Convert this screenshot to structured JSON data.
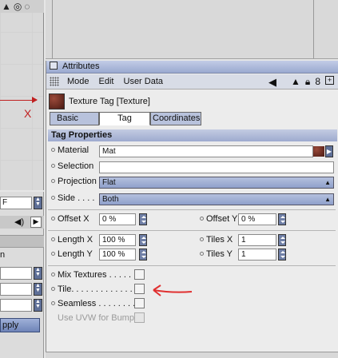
{
  "left_panel": {
    "top_icons": [
      "▲",
      "◎",
      "◌"
    ],
    "axis_label": "X",
    "field1_value": "F",
    "field3_value": "n",
    "apply_label": "pply"
  },
  "attributes": {
    "title": "Attributes",
    "menu": [
      "Mode",
      "Edit",
      "User Data"
    ],
    "menu_icons": [
      "back-arrow-icon",
      "up-arrow-icon",
      "lock-icon",
      "hierarchy-icon",
      "new-window-icon"
    ],
    "tag_title": "Texture Tag [Texture]",
    "tabs": [
      "Basic",
      "Tag",
      "Coordinates"
    ],
    "active_tab": "Tag",
    "section_title": "Tag Properties",
    "material_label": "Material",
    "material_value": "Mat",
    "selection_label": "Selection",
    "selection_value": "",
    "projection_label": "Projection",
    "projection_value": "Flat",
    "side_label": "Side . . . .",
    "side_value": "Both",
    "offset_x_label": "Offset X",
    "offset_x_value": "0 %",
    "offset_y_label": "Offset Y",
    "offset_y_value": "0 %",
    "length_x_label": "Length X",
    "length_x_value": "100 %",
    "tiles_x_label": "Tiles X",
    "tiles_x_value": "1",
    "length_y_label": "Length Y",
    "length_y_value": "100 %",
    "tiles_y_label": "Tiles Y",
    "tiles_y_value": "1",
    "mix_textures_label": "Mix Textures . . . . . .",
    "tile_label": "Tile. . . . . . . . . . . . .",
    "seamless_label": "Seamless . . . . . . . .",
    "use_uvw_label": "Use UVW for Bump"
  },
  "colors": {
    "annotation_arrow": "#e03030",
    "axis": "#c02020"
  }
}
